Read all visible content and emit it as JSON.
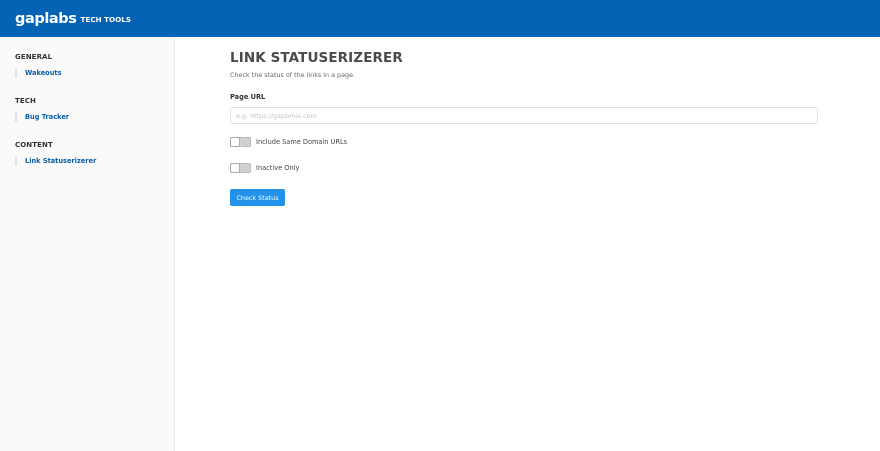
{
  "header": {
    "brand": "gaplabs",
    "subtitle": "TECH TOOLS",
    "background": "#0563b5"
  },
  "sidebar": {
    "sections": [
      {
        "heading": "GENERAL",
        "items": [
          {
            "label": "Wakeouts"
          }
        ]
      },
      {
        "heading": "TECH",
        "items": [
          {
            "label": "Bug Tracker"
          }
        ]
      },
      {
        "heading": "CONTENT",
        "items": [
          {
            "label": "Link Statuserizerer",
            "active": true
          }
        ]
      }
    ]
  },
  "main": {
    "title": "LINK STATUSERIZERER",
    "subtitle": "Check the status of the links in a page.",
    "url_field": {
      "label": "Page URL",
      "placeholder": "e.g. https://gapbmal.com",
      "value": ""
    },
    "toggles": [
      {
        "label": "Include Same Domain URLs",
        "on": false
      },
      {
        "label": "Inactive Only",
        "on": false
      }
    ],
    "submit_label": "Check Status"
  },
  "colors": {
    "accent": "#0a5eab",
    "button": "#2592e9",
    "sidebar_bg": "#fafafa"
  }
}
